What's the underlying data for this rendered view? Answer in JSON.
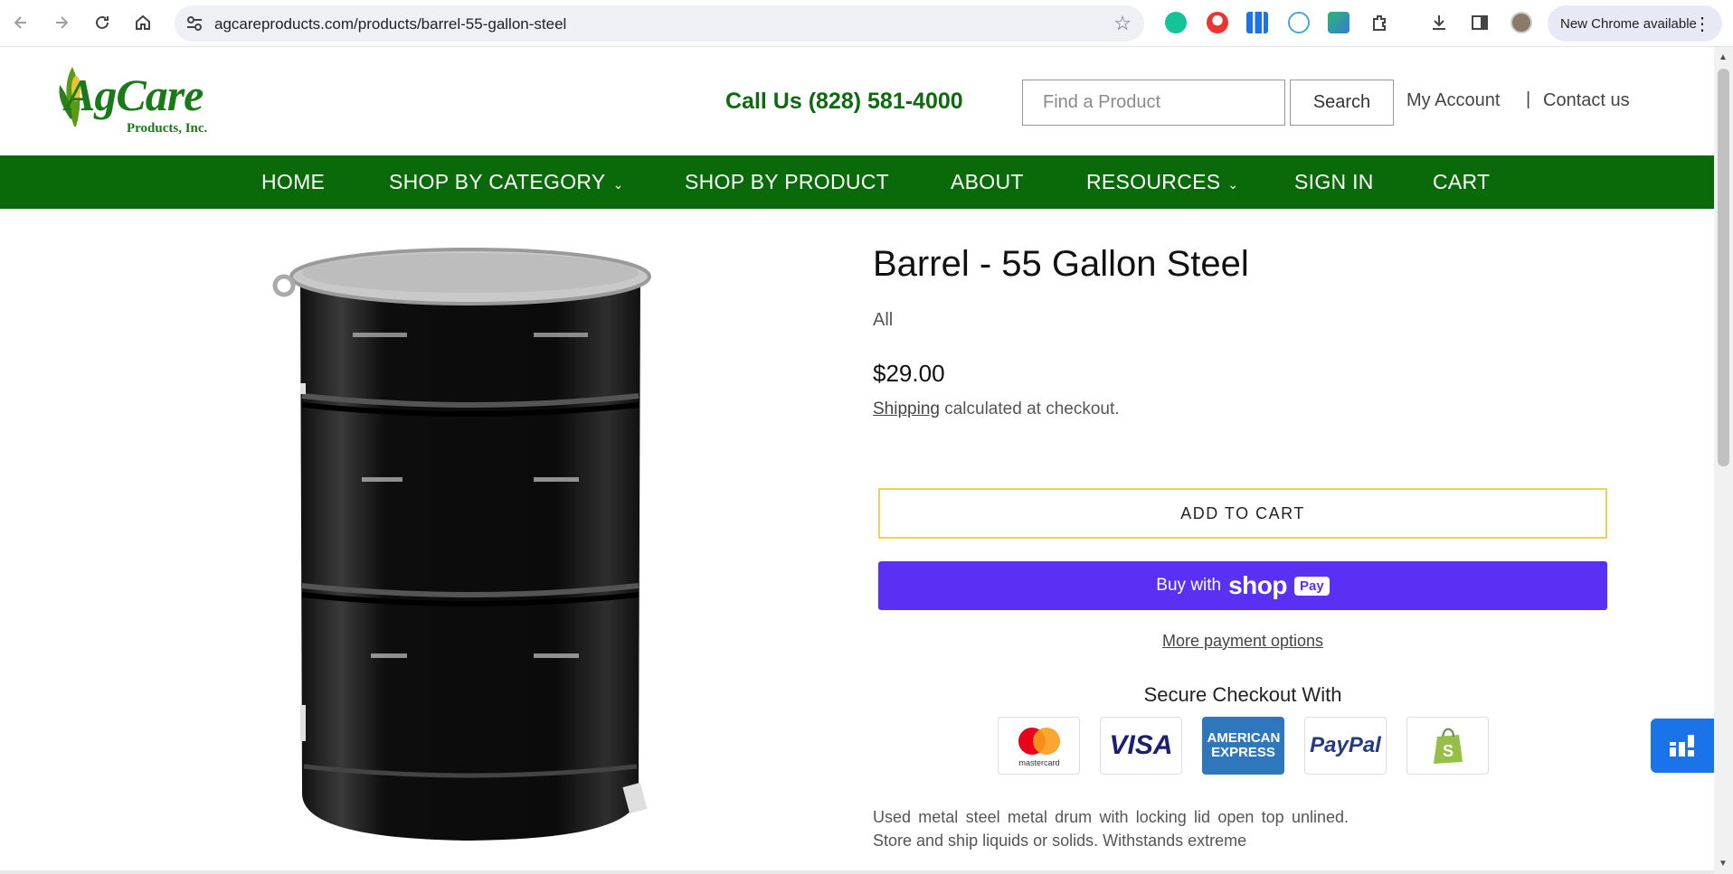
{
  "browser": {
    "url": "agcareproducts.com/products/barrel-55-gallon-steel",
    "update_label": "New Chrome available"
  },
  "header": {
    "logo_word": "AgCare",
    "logo_sub": "Products, Inc.",
    "phone": "Call Us (828) 581-4000",
    "search_placeholder": "Find a Product",
    "search_button": "Search",
    "my_account": "My Account",
    "separator": "|",
    "contact": "Contact us"
  },
  "nav": {
    "items": [
      {
        "label": "HOME"
      },
      {
        "label": "SHOP BY CATEGORY",
        "caret": "⌄"
      },
      {
        "label": "SHOP BY PRODUCT"
      },
      {
        "label": "ABOUT"
      },
      {
        "label": "RESOURCES",
        "caret": "⌄"
      },
      {
        "label": "SIGN IN"
      },
      {
        "label": "CART"
      }
    ]
  },
  "product": {
    "title": "Barrel - 55 Gallon Steel",
    "vendor": "All",
    "price": "$29.00",
    "shipping_link": "Shipping",
    "shipping_rest": " calculated at checkout.",
    "add_to_cart": "ADD TO CART",
    "buy_with": "Buy with",
    "shop_word": "shop",
    "pay_badge": "Pay",
    "more_payment": "More payment options",
    "secure_title": "Secure Checkout With",
    "payment_methods": [
      "mastercard",
      "VISA",
      "AMERICAN EXPRESS",
      "PayPal",
      "shopify"
    ],
    "description": "Used metal steel metal drum with locking lid open top unlined. Store and ship liquids or solids. Withstands extreme"
  },
  "colors": {
    "brand_green": "#0a6a0a",
    "shop_pay_purple": "#5a31f4",
    "add_to_cart_border": "#f2d24a"
  }
}
